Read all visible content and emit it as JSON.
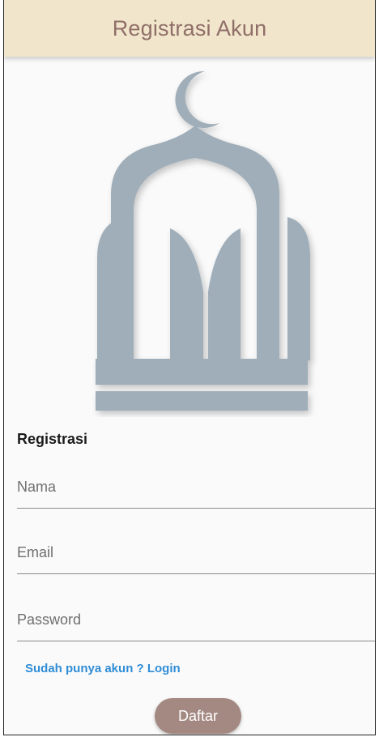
{
  "appbar": {
    "title": "Registrasi Akun"
  },
  "logo": {
    "icon": "mosque-crescent-icon",
    "color": "#9faeb9"
  },
  "form": {
    "section_title": "Registrasi",
    "fields": {
      "nama": {
        "placeholder": "Nama",
        "value": ""
      },
      "email": {
        "placeholder": "Email",
        "value": ""
      },
      "password": {
        "placeholder": "Password",
        "value": ""
      }
    },
    "login_link": "Sudah punya akun ? Login",
    "submit_label": "Daftar"
  },
  "colors": {
    "appbar_bg": "#f1e5cb",
    "title": "#8f6f68",
    "link": "#2f8dd6",
    "button": "#a48982"
  }
}
